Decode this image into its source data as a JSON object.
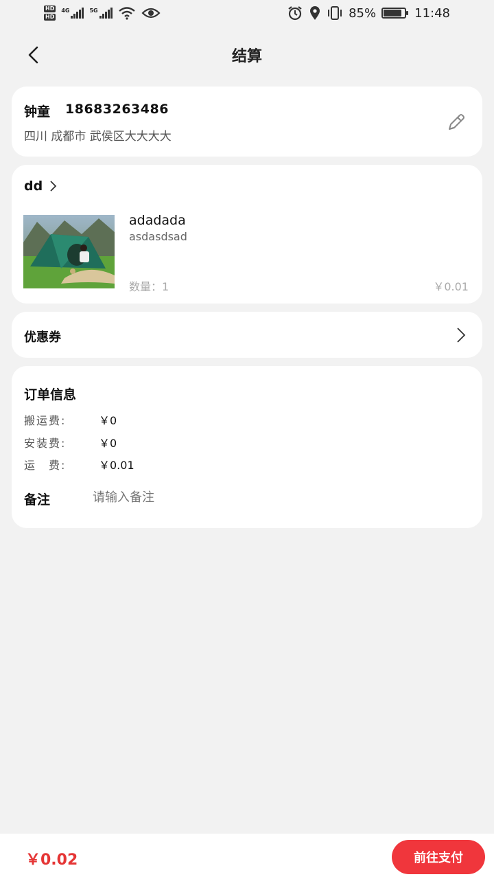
{
  "status_bar": {
    "network_1": "4G",
    "network_2": "5G",
    "battery": "85%",
    "time": "11:48",
    "icons": [
      "hd-icon",
      "signal-icon",
      "wifi-icon",
      "eye-icon",
      "alarm-icon",
      "location-icon",
      "vibrate-icon",
      "battery-icon"
    ]
  },
  "nav": {
    "title": "结算"
  },
  "address": {
    "name": "钟童",
    "phone": "18683263486",
    "detail": "四川 成都市 武侯区大大大大"
  },
  "shop": {
    "name": "dd"
  },
  "goods": {
    "title": "adadada",
    "spec": "asdasdsad",
    "qty_label": "数量：1",
    "price": "￥0.01",
    "image": "tent-photo"
  },
  "coupon": {
    "label": "优惠券"
  },
  "order_info": {
    "title": "订单信息",
    "fees": [
      {
        "label": "搬运费:",
        "value": "￥0"
      },
      {
        "label": "安装费:",
        "value": "￥0"
      },
      {
        "label": "运　费:",
        "value": "￥0.01"
      }
    ],
    "remark_label": "备注",
    "remark_placeholder": "请输入备注"
  },
  "bottom": {
    "total": "￥0.02",
    "pay_label": "前往支付"
  },
  "colors": {
    "accent": "#f0363c",
    "price_red": "#e53535",
    "background": "#f2f2f2"
  }
}
